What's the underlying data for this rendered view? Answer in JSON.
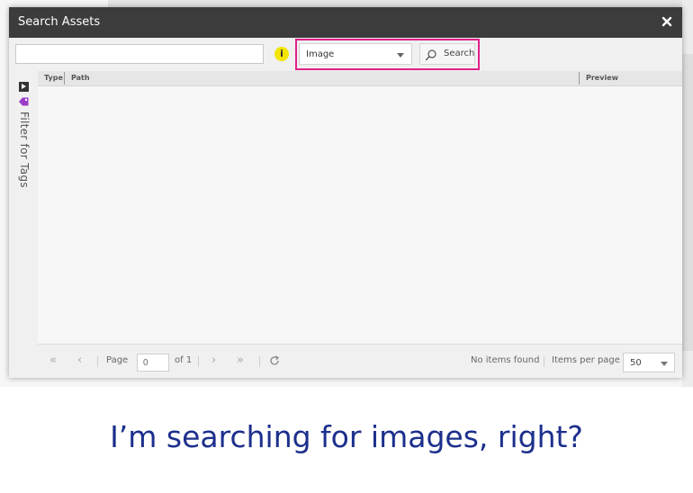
{
  "dialog": {
    "title": "Search Assets"
  },
  "toolbar": {
    "query_value": "",
    "type_filter": "Image",
    "search_label": "Search"
  },
  "sidebar": {
    "filter_label": "Filter for Tags"
  },
  "grid": {
    "columns": [
      "Type",
      "Path",
      "Preview"
    ],
    "rows": []
  },
  "pager": {
    "page_label": "Page",
    "page_value": "0",
    "of_label": "of 1",
    "status": "No items found",
    "per_page_label": "Items per page",
    "per_page_value": "50"
  },
  "caption": {
    "text": "I’m searching for images, right?"
  },
  "colors": {
    "highlight": "#e0208a",
    "titlebar": "#3c3c3c",
    "caption": "#1c2f8c",
    "info": "#f3e500"
  }
}
